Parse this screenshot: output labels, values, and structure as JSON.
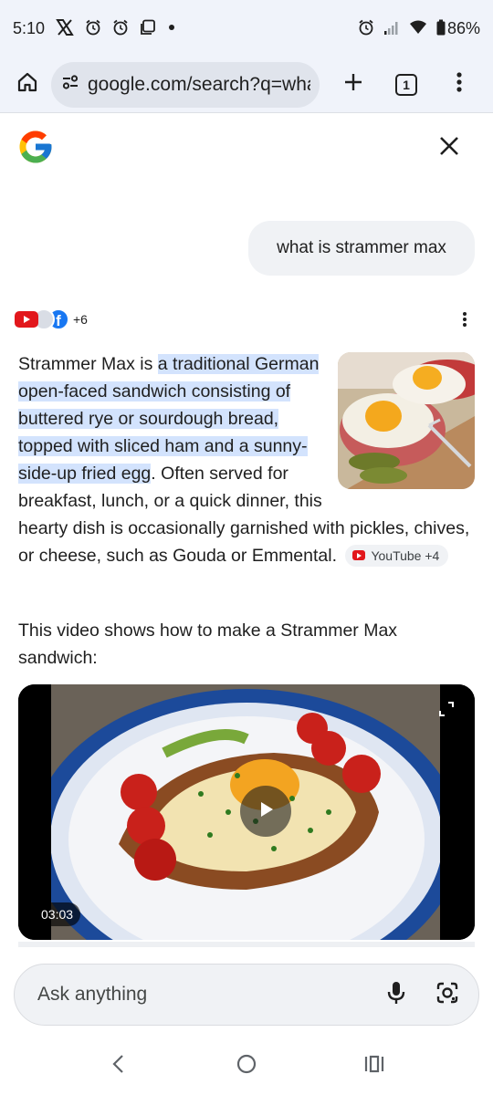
{
  "status_bar": {
    "time": "5:10",
    "battery": "86%",
    "left_icons": [
      "x-icon",
      "alarm-icon",
      "alarm-icon",
      "screen-icon",
      "dot-icon"
    ],
    "right_icons": [
      "alarm-icon",
      "signal-icon",
      "wifi-icon",
      "battery-icon"
    ]
  },
  "browser": {
    "url": "google.com/search?q=wha",
    "tab_count": "1"
  },
  "chat": {
    "user_query": "what is strammer max",
    "sources_more": "+6",
    "answer": {
      "intro": "Strammer Max is ",
      "highlight": "a traditional German open-faced sandwich consisting of buttered rye or sourdough bread, topped with sliced ham and a sunny-side-up fried egg",
      "rest": ". Often served for breakfast, lunch, or a quick dinner, this hearty dish is occasionally garnished with pickles, chives, or cheese, such as Gouda or Emmental.",
      "source_chip": "YouTube +4"
    },
    "video_intro": "This video shows how to make a Strammer Max sandwich:",
    "video_duration": "03:03"
  },
  "ask_bar": {
    "placeholder": "Ask anything"
  },
  "colors": {
    "highlight": "#d3e3fd",
    "youtube_red": "#e2171c",
    "facebook_blue": "#1877f2",
    "surface": "#f0f3fa"
  }
}
